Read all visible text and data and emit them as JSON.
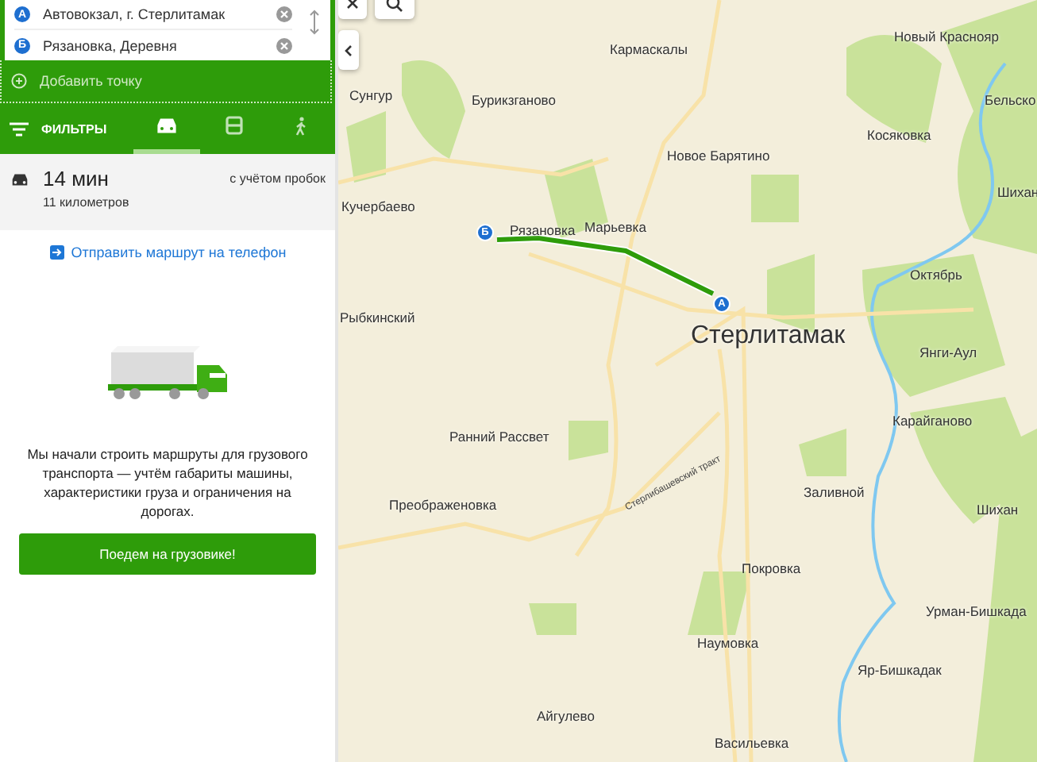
{
  "route": {
    "points": [
      {
        "letter": "А",
        "value": "Автовокзал, г. Стерлитамак"
      },
      {
        "letter": "Б",
        "value": "Рязановка, Деревня"
      }
    ],
    "add_point": "Добавить точку"
  },
  "filters": {
    "label": "ФИЛЬТРЫ",
    "modes": [
      {
        "kind": "car",
        "selected": true
      },
      {
        "kind": "bus",
        "selected": false
      },
      {
        "kind": "walk",
        "selected": false
      }
    ]
  },
  "summary": {
    "time": "14 мин",
    "distance": "11 километров",
    "note": "с учётом пробок"
  },
  "send_link": "Отправить маршрут на телефон",
  "truck_promo": {
    "text": "Мы начали строить маршруты для грузового транспорта — учтём габариты машины, характеристики груза и ограничения на дорогах.",
    "button": "Поедем на грузовике!"
  },
  "map": {
    "labels": [
      {
        "text": "Кармаскалы",
        "kind": "village"
      },
      {
        "text": "Новый Краснояр",
        "kind": "village"
      },
      {
        "text": "Сунгур",
        "kind": "village"
      },
      {
        "text": "Бурикзганово",
        "kind": "village"
      },
      {
        "text": "Бельско",
        "kind": "village"
      },
      {
        "text": "Косяковка",
        "kind": "village"
      },
      {
        "text": "Новое Барятино",
        "kind": "village"
      },
      {
        "text": "Шихан",
        "kind": "village"
      },
      {
        "text": "Кучербаево",
        "kind": "village"
      },
      {
        "text": "Марьевка",
        "kind": "village"
      },
      {
        "text": "Рязановка",
        "kind": "village"
      },
      {
        "text": "Октябрь",
        "kind": "village"
      },
      {
        "text": "Рыбкинский",
        "kind": "village"
      },
      {
        "text": "Стерлитамак",
        "kind": "city"
      },
      {
        "text": "Янги-Аул",
        "kind": "village"
      },
      {
        "text": "Карайганово",
        "kind": "village"
      },
      {
        "text": "Ранний Рассвет",
        "kind": "village"
      },
      {
        "text": "Стерлибашевский тракт",
        "kind": "road"
      },
      {
        "text": "Преображеновка",
        "kind": "village"
      },
      {
        "text": "Заливной",
        "kind": "village"
      },
      {
        "text": "Шихан",
        "kind": "village"
      },
      {
        "text": "Покровка",
        "kind": "village"
      },
      {
        "text": "Урман-Бишкада",
        "kind": "village"
      },
      {
        "text": "Наумовка",
        "kind": "village"
      },
      {
        "text": "Яр-Бишкадак",
        "kind": "village"
      },
      {
        "text": "Айгулево",
        "kind": "village"
      },
      {
        "text": "Васильевка",
        "kind": "village"
      }
    ],
    "markers": [
      {
        "letter": "А"
      },
      {
        "letter": "Б"
      }
    ]
  }
}
